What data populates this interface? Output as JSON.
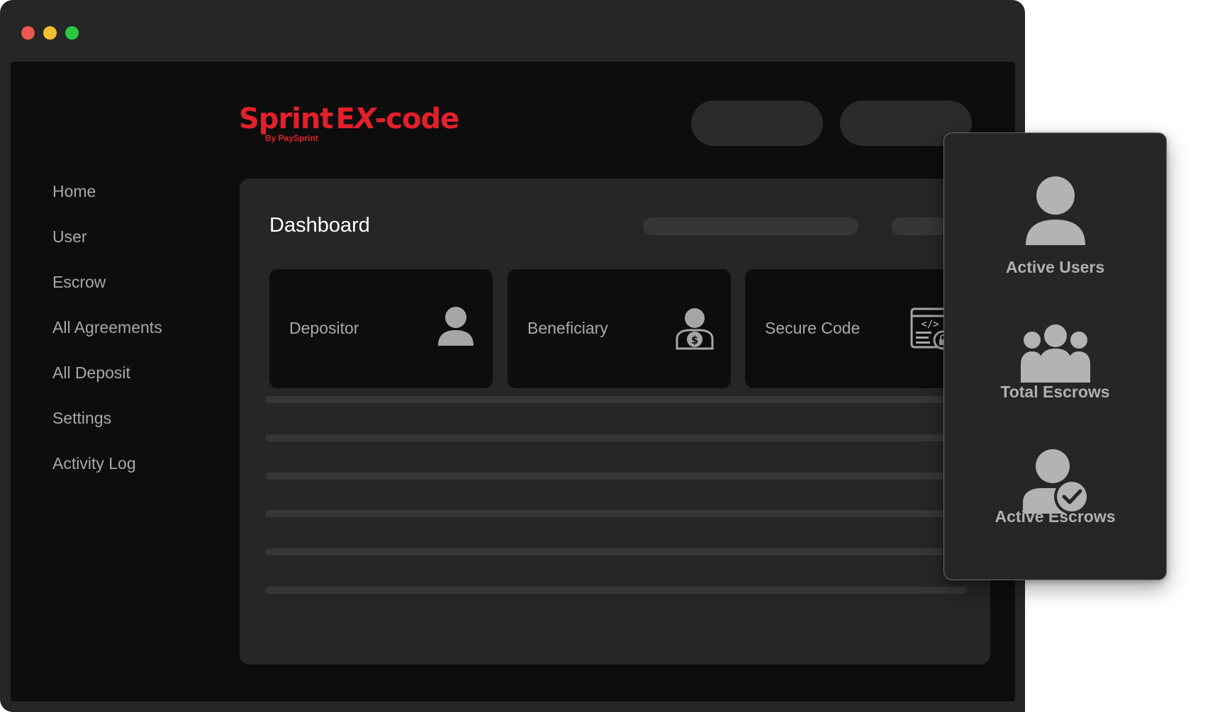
{
  "app": {
    "brand": "SprintEX-code",
    "brand_parts": {
      "sprint": "Sprint",
      "e": "E",
      "x": "X",
      "code": "-code"
    },
    "brand_sub": "By PaySprint",
    "brand_color": "#e3202a"
  },
  "sidebar": {
    "items": [
      {
        "label": "Home"
      },
      {
        "label": "User"
      },
      {
        "label": "Escrow"
      },
      {
        "label": "All Agreements"
      },
      {
        "label": "All Deposit"
      },
      {
        "label": "Settings"
      },
      {
        "label": "Activity Log"
      }
    ]
  },
  "dashboard": {
    "title": "Dashboard",
    "cards": [
      {
        "label": "Depositor",
        "icon": "user-icon"
      },
      {
        "label": "Beneficiary",
        "icon": "user-dollar-icon"
      },
      {
        "label": "Secure Code",
        "icon": "code-lock-icon"
      }
    ]
  },
  "stats_popup": {
    "items": [
      {
        "label": "Active Users",
        "icon": "user-icon"
      },
      {
        "label": "Total Escrows",
        "icon": "group-icon"
      },
      {
        "label": "Active Escrows",
        "icon": "user-check-icon"
      }
    ]
  }
}
